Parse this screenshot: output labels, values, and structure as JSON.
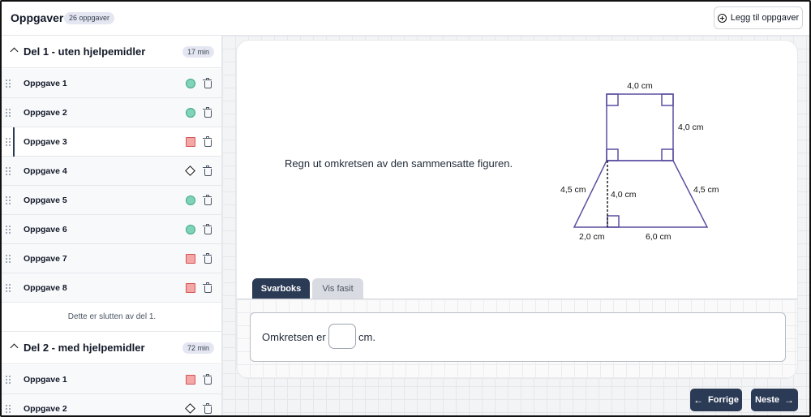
{
  "header": {
    "title": "Oppgaver",
    "count_badge": "26 oppgaver",
    "add_button": "Legg til oppgaver",
    "add_icon": "plus-circle-icon"
  },
  "sidebar": {
    "sections": [
      {
        "title": "Del 1 - uten hjelpemidler",
        "time": "17 min",
        "tasks": [
          {
            "label": "Oppgave 1",
            "status": "circle"
          },
          {
            "label": "Oppgave 2",
            "status": "circle"
          },
          {
            "label": "Oppgave 3",
            "status": "square",
            "active": true
          },
          {
            "label": "Oppgave 4",
            "status": "diamond"
          },
          {
            "label": "Oppgave 5",
            "status": "circle"
          },
          {
            "label": "Oppgave 6",
            "status": "circle"
          },
          {
            "label": "Oppgave 7",
            "status": "square"
          },
          {
            "label": "Oppgave 8",
            "status": "square"
          }
        ],
        "end_text": "Dette er slutten av del 1."
      },
      {
        "title": "Del 2 - med hjelpemidler",
        "time": "72 min",
        "tasks": [
          {
            "label": "Oppgave 1",
            "status": "square"
          },
          {
            "label": "Oppgave 2",
            "status": "diamond"
          }
        ]
      }
    ],
    "status_colors": {
      "circle": "#7fd4b8",
      "square": "#f4a7a7",
      "diamond": "#111111"
    }
  },
  "main": {
    "question": "Regn ut omkretsen av den sammensatte figuren.",
    "figure": {
      "labels": {
        "top": "4,0 cm",
        "right": "4,0 cm",
        "left_slant": "4,5 cm",
        "right_slant": "4,5 cm",
        "height": "4,0 cm",
        "bottom_left": "2,0 cm",
        "bottom_right": "6,0 cm"
      },
      "stroke_color": "#5b4fa0"
    },
    "tabs": [
      {
        "label": "Svarboks",
        "active": true
      },
      {
        "label": "Vis fasit",
        "active": false
      }
    ],
    "answer": {
      "prefix": "Omkretsen er",
      "value": "",
      "suffix": "cm."
    },
    "nav": {
      "prev": "Forrige",
      "next": "Neste"
    }
  },
  "colors": {
    "accent": "#2b3a55",
    "badge_bg": "#e4e6f1"
  }
}
